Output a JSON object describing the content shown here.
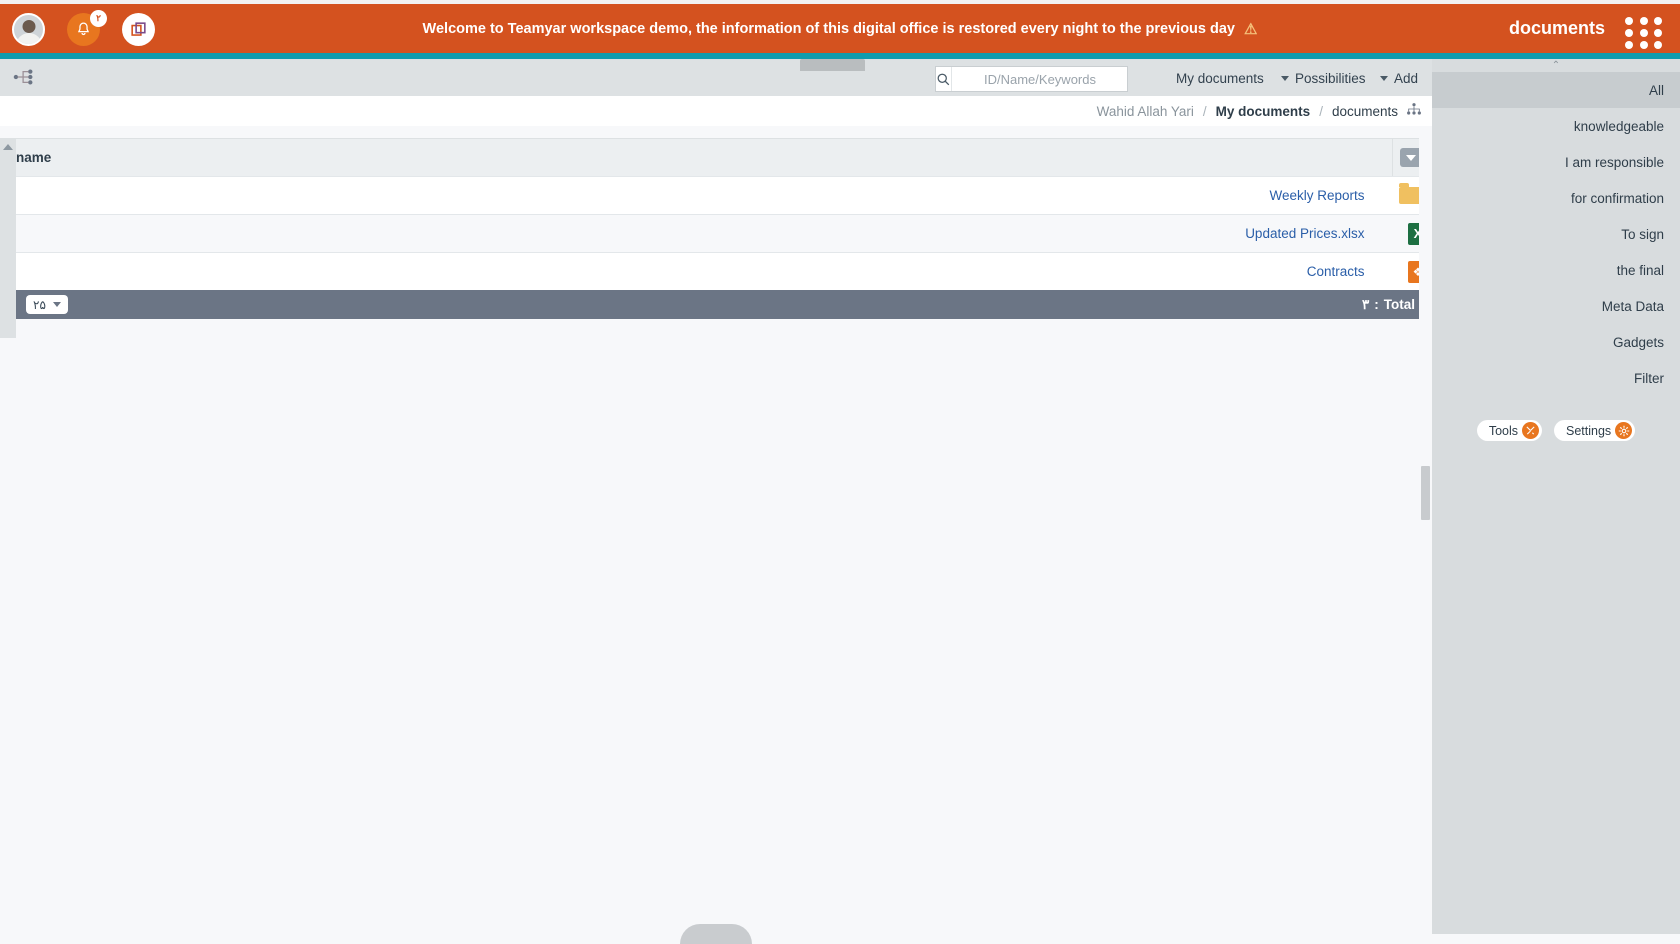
{
  "topbar": {
    "welcome_text": "Welcome to Teamyar workspace demo, the information of this digital office is restored every night to the previous day",
    "warn_icon": "warning-triangle-icon",
    "warn_glyph": "⚠",
    "app_title": "documents",
    "notification_count": "۲",
    "bell_icon": "bell-icon",
    "bell_glyph": "🔔",
    "copy_icon": "copy-icon",
    "grid_icon": "apps-grid-icon",
    "avatar_name": "user-avatar",
    "accent_orange": "#d4521f",
    "accent_teal": "#0f9cad",
    "badge_orange": "#e8761f"
  },
  "toolbar": {
    "hierarchy_icon": "hierarchy-icon",
    "search": {
      "icon": "search-icon",
      "placeholder": "ID/Name/Keywords",
      "value": ""
    },
    "my_documents_label": "My documents",
    "possibilities_label": "Possibilities",
    "add_label": "Add"
  },
  "breadcrumb": {
    "user": "Wahid Allah Yari",
    "sep": "/",
    "parent": "My documents",
    "current": "documents",
    "tree_icon": "hierarchy-icon"
  },
  "table": {
    "columns": [
      "name"
    ],
    "header_menu_icon": "chevron-down-icon",
    "rows": [
      {
        "name": "Weekly Reports",
        "icon": "folder-icon",
        "type": "folder"
      },
      {
        "name": "Updated Prices.xlsx",
        "icon": "excel-file-icon",
        "type": "xls",
        "glyph": "X"
      },
      {
        "name": "Contracts",
        "icon": "cad-file-icon",
        "type": "cad",
        "glyph": "❖"
      }
    ],
    "footer": {
      "page_size": "۲۵",
      "total_label": "Total",
      "total_separator": ":",
      "total_count": "۳"
    }
  },
  "sidebar": {
    "collapse_icon": "chevron-up-icon",
    "items": [
      {
        "label": "All",
        "active": true
      },
      {
        "label": "knowledgeable",
        "active": false
      },
      {
        "label": "I am responsible",
        "active": false
      },
      {
        "label": "for confirmation",
        "active": false
      },
      {
        "label": "To sign",
        "active": false
      },
      {
        "label": "the final",
        "active": false
      },
      {
        "label": "Meta Data",
        "active": false
      },
      {
        "label": "Gadgets",
        "active": false
      },
      {
        "label": "Filter",
        "active": false
      }
    ],
    "actions": [
      {
        "label": "Tools",
        "icon": "tools-icon",
        "glyph": "✂"
      },
      {
        "label": "Settings",
        "icon": "gear-icon",
        "glyph": "⚙"
      }
    ]
  }
}
